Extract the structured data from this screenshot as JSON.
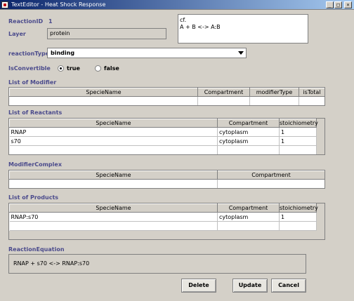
{
  "window": {
    "title": "TextEditor - Heat Shock Response",
    "minimize": "_",
    "maximize": "□",
    "close": "×"
  },
  "form": {
    "reaction_id_label": "ReactionID",
    "reaction_id_value": "1",
    "layer_label": "Layer",
    "layer_value": "protein",
    "note_lines": [
      "cf.",
      "A + B <-> A:B"
    ],
    "reaction_type_label": "reactionType",
    "reaction_type_value": "binding",
    "is_convertible_label": "IsConvertible",
    "true_label": "true",
    "false_label": "false"
  },
  "modifier": {
    "section_label": "List of Modifier",
    "headers": [
      "SpecieName",
      "Compartment",
      "modifierType",
      "isTotal"
    ]
  },
  "reactants": {
    "section_label": "List of Reactants",
    "headers": [
      "SpecieName",
      "Compartment",
      "stoichiometry"
    ],
    "rows": [
      [
        "RNAP",
        "cytoplasm",
        "1"
      ],
      [
        "s70",
        "cytoplasm",
        "1"
      ]
    ]
  },
  "modifier_complex": {
    "section_label": "ModifierComplex",
    "headers": [
      "SpecieName",
      "Compartment"
    ]
  },
  "products": {
    "section_label": "List of Products",
    "headers": [
      "SpecieName",
      "Compartment",
      "stoichiometry"
    ],
    "rows": [
      [
        "RNAP:s70",
        "cytoplasm",
        "1"
      ]
    ]
  },
  "equation": {
    "section_label": "ReactionEquation",
    "value": "RNAP + s70 <-> RNAP:s70"
  },
  "buttons": {
    "delete": "Delete",
    "update": "Update",
    "cancel": "Cancel"
  },
  "colors": {
    "label": "#4b4b8c",
    "titlebar_start": "#0a246a",
    "background": "#d4d0c8"
  }
}
